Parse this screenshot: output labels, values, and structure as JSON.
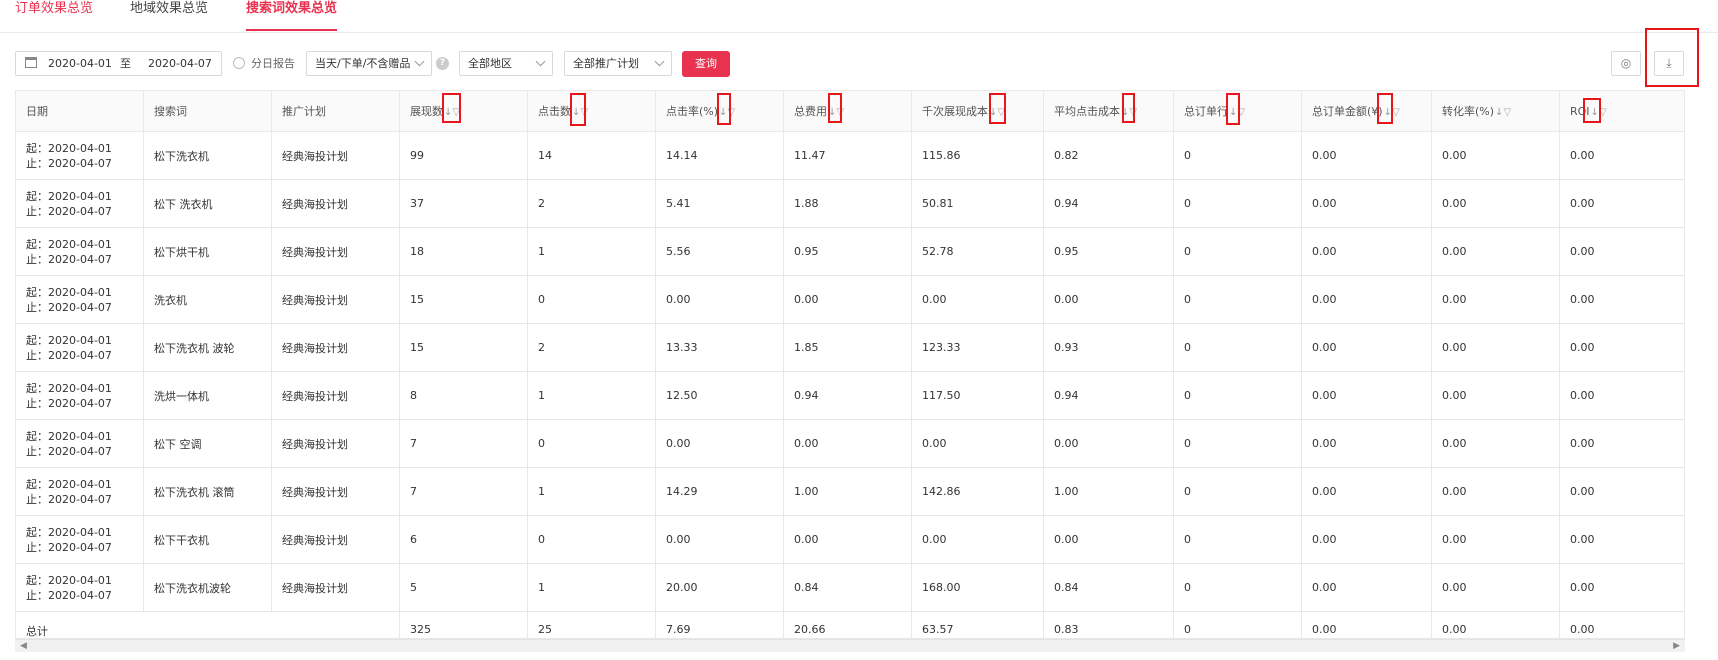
{
  "tabs": [
    "订单效果总览",
    "地域效果总览",
    "搜索词效果总览"
  ],
  "filters": {
    "start_date": "2020-04-01",
    "to_label": "至",
    "end_date": "2020-04-07",
    "daily_report_label": "分日报告",
    "order_type": "当天/下单/不含赠品",
    "region": "全部地区",
    "plan": "全部推广计划",
    "query_button": "查询"
  },
  "toolbar_icons": [
    "settings-icon",
    "download-icon"
  ],
  "table": {
    "columns": [
      "日期",
      "搜索词",
      "推广计划",
      "展现数",
      "点击数",
      "点击率(%)",
      "总费用",
      "千次展现成本",
      "平均点击成本",
      "总订单行",
      "总订单金额(¥)",
      "转化率(%)",
      "ROI"
    ],
    "rows": [
      [
        "起：2020-04-01止：2020-04-07",
        "松下洗衣机",
        "经典海投计划",
        "99",
        "14",
        "14.14",
        "11.47",
        "115.86",
        "0.82",
        "0",
        "0.00",
        "0.00",
        "0.00"
      ],
      [
        "起：2020-04-01止：2020-04-07",
        "松下 洗衣机",
        "经典海投计划",
        "37",
        "2",
        "5.41",
        "1.88",
        "50.81",
        "0.94",
        "0",
        "0.00",
        "0.00",
        "0.00"
      ],
      [
        "起：2020-04-01止：2020-04-07",
        "松下烘干机",
        "经典海投计划",
        "18",
        "1",
        "5.56",
        "0.95",
        "52.78",
        "0.95",
        "0",
        "0.00",
        "0.00",
        "0.00"
      ],
      [
        "起：2020-04-01止：2020-04-07",
        "洗衣机",
        "经典海投计划",
        "15",
        "0",
        "0.00",
        "0.00",
        "0.00",
        "0.00",
        "0",
        "0.00",
        "0.00",
        "0.00"
      ],
      [
        "起：2020-04-01止：2020-04-07",
        "松下洗衣机 波轮",
        "经典海投计划",
        "15",
        "2",
        "13.33",
        "1.85",
        "123.33",
        "0.93",
        "0",
        "0.00",
        "0.00",
        "0.00"
      ],
      [
        "起：2020-04-01止：2020-04-07",
        "洗烘一体机",
        "经典海投计划",
        "8",
        "1",
        "12.50",
        "0.94",
        "117.50",
        "0.94",
        "0",
        "0.00",
        "0.00",
        "0.00"
      ],
      [
        "起：2020-04-01止：2020-04-07",
        "松下 空调",
        "经典海投计划",
        "7",
        "0",
        "0.00",
        "0.00",
        "0.00",
        "0.00",
        "0",
        "0.00",
        "0.00",
        "0.00"
      ],
      [
        "起：2020-04-01止：2020-04-07",
        "松下洗衣机 滚筒",
        "经典海投计划",
        "7",
        "1",
        "14.29",
        "1.00",
        "142.86",
        "1.00",
        "0",
        "0.00",
        "0.00",
        "0.00"
      ],
      [
        "起：2020-04-01止：2020-04-07",
        "松下干衣机",
        "经典海投计划",
        "6",
        "0",
        "0.00",
        "0.00",
        "0.00",
        "0.00",
        "0",
        "0.00",
        "0.00",
        "0.00"
      ],
      [
        "起：2020-04-01止：2020-04-07",
        "松下洗衣机波轮",
        "经典海投计划",
        "5",
        "1",
        "20.00",
        "0.84",
        "168.00",
        "0.84",
        "0",
        "0.00",
        "0.00",
        "0.00"
      ]
    ],
    "total": {
      "label": "总计",
      "values": [
        "325",
        "25",
        "7.69",
        "20.66",
        "63.57",
        "0.83",
        "0",
        "0.00",
        "0.00",
        "0.00"
      ]
    }
  },
  "colors": {
    "accent": "#e8324f",
    "highlight_box": "#e8151b"
  }
}
